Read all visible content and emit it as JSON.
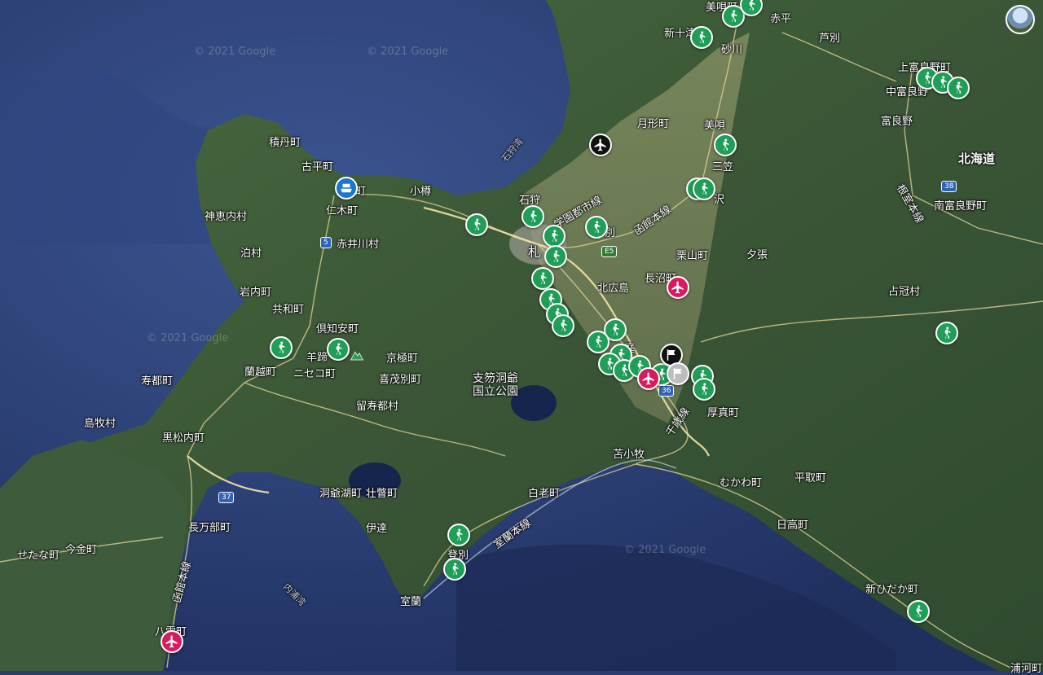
{
  "map": {
    "watermarks": [
      "© 2021 Google",
      "© 2021 Google",
      "© 2021 Google",
      "© 2021 Google"
    ],
    "region_label": "北海道",
    "sea_labels": [
      "石狩湾",
      "内浦湾"
    ],
    "park_label_line1": "支笏洞爺",
    "park_label_line2": "国立公園",
    "place_labels": [
      "美唄町",
      "赤平",
      "新十津",
      "砂川",
      "芦別",
      "上富良野町",
      "中富良野",
      "富良野",
      "南富良野町",
      "月形町",
      "美唄",
      "三笠",
      "沢",
      "積丹町",
      "古平町",
      "町",
      "小樽",
      "神恵内村",
      "仁木町",
      "赤井川村",
      "泊村",
      "石狩",
      "学園都市線",
      "函館本線",
      "別",
      "札",
      "栗山町",
      "夕張",
      "岩内町",
      "共和町",
      "長沼町",
      "北広島",
      "占冠村",
      "倶知安町",
      "羊蹄",
      "京極町",
      "蘭越町",
      "ニセコ町",
      "喜茂別町",
      "庭",
      "寿都町",
      "島牧村",
      "黒松内町",
      "留寿都村",
      "厚真町",
      "苫小牧",
      "千歳線",
      "むかわ町",
      "平取町",
      "洞爺湖町",
      "壮瞥町",
      "白老町",
      "伊達",
      "長万部町",
      "今金町",
      "せたな町",
      "室蘭本線",
      "登別",
      "室蘭",
      "日高町",
      "新ひだか町",
      "函館本線",
      "八雲町",
      "浦河町",
      "根室本線"
    ],
    "road_shields": [
      "5",
      "E5",
      "36",
      "37",
      "38"
    ]
  },
  "markers": {
    "walk": "hiking-icon",
    "airport": "airport-icon",
    "ferry": "ferry-icon",
    "flag": "flag-icon",
    "mountain": "mountain-icon"
  },
  "colors": {
    "sea": "#2b3d6e",
    "land": "#3d5a3a",
    "walk_marker": "#1e9e57",
    "airport_marker": "#d81b60",
    "ferry_marker": "#1976d2"
  }
}
